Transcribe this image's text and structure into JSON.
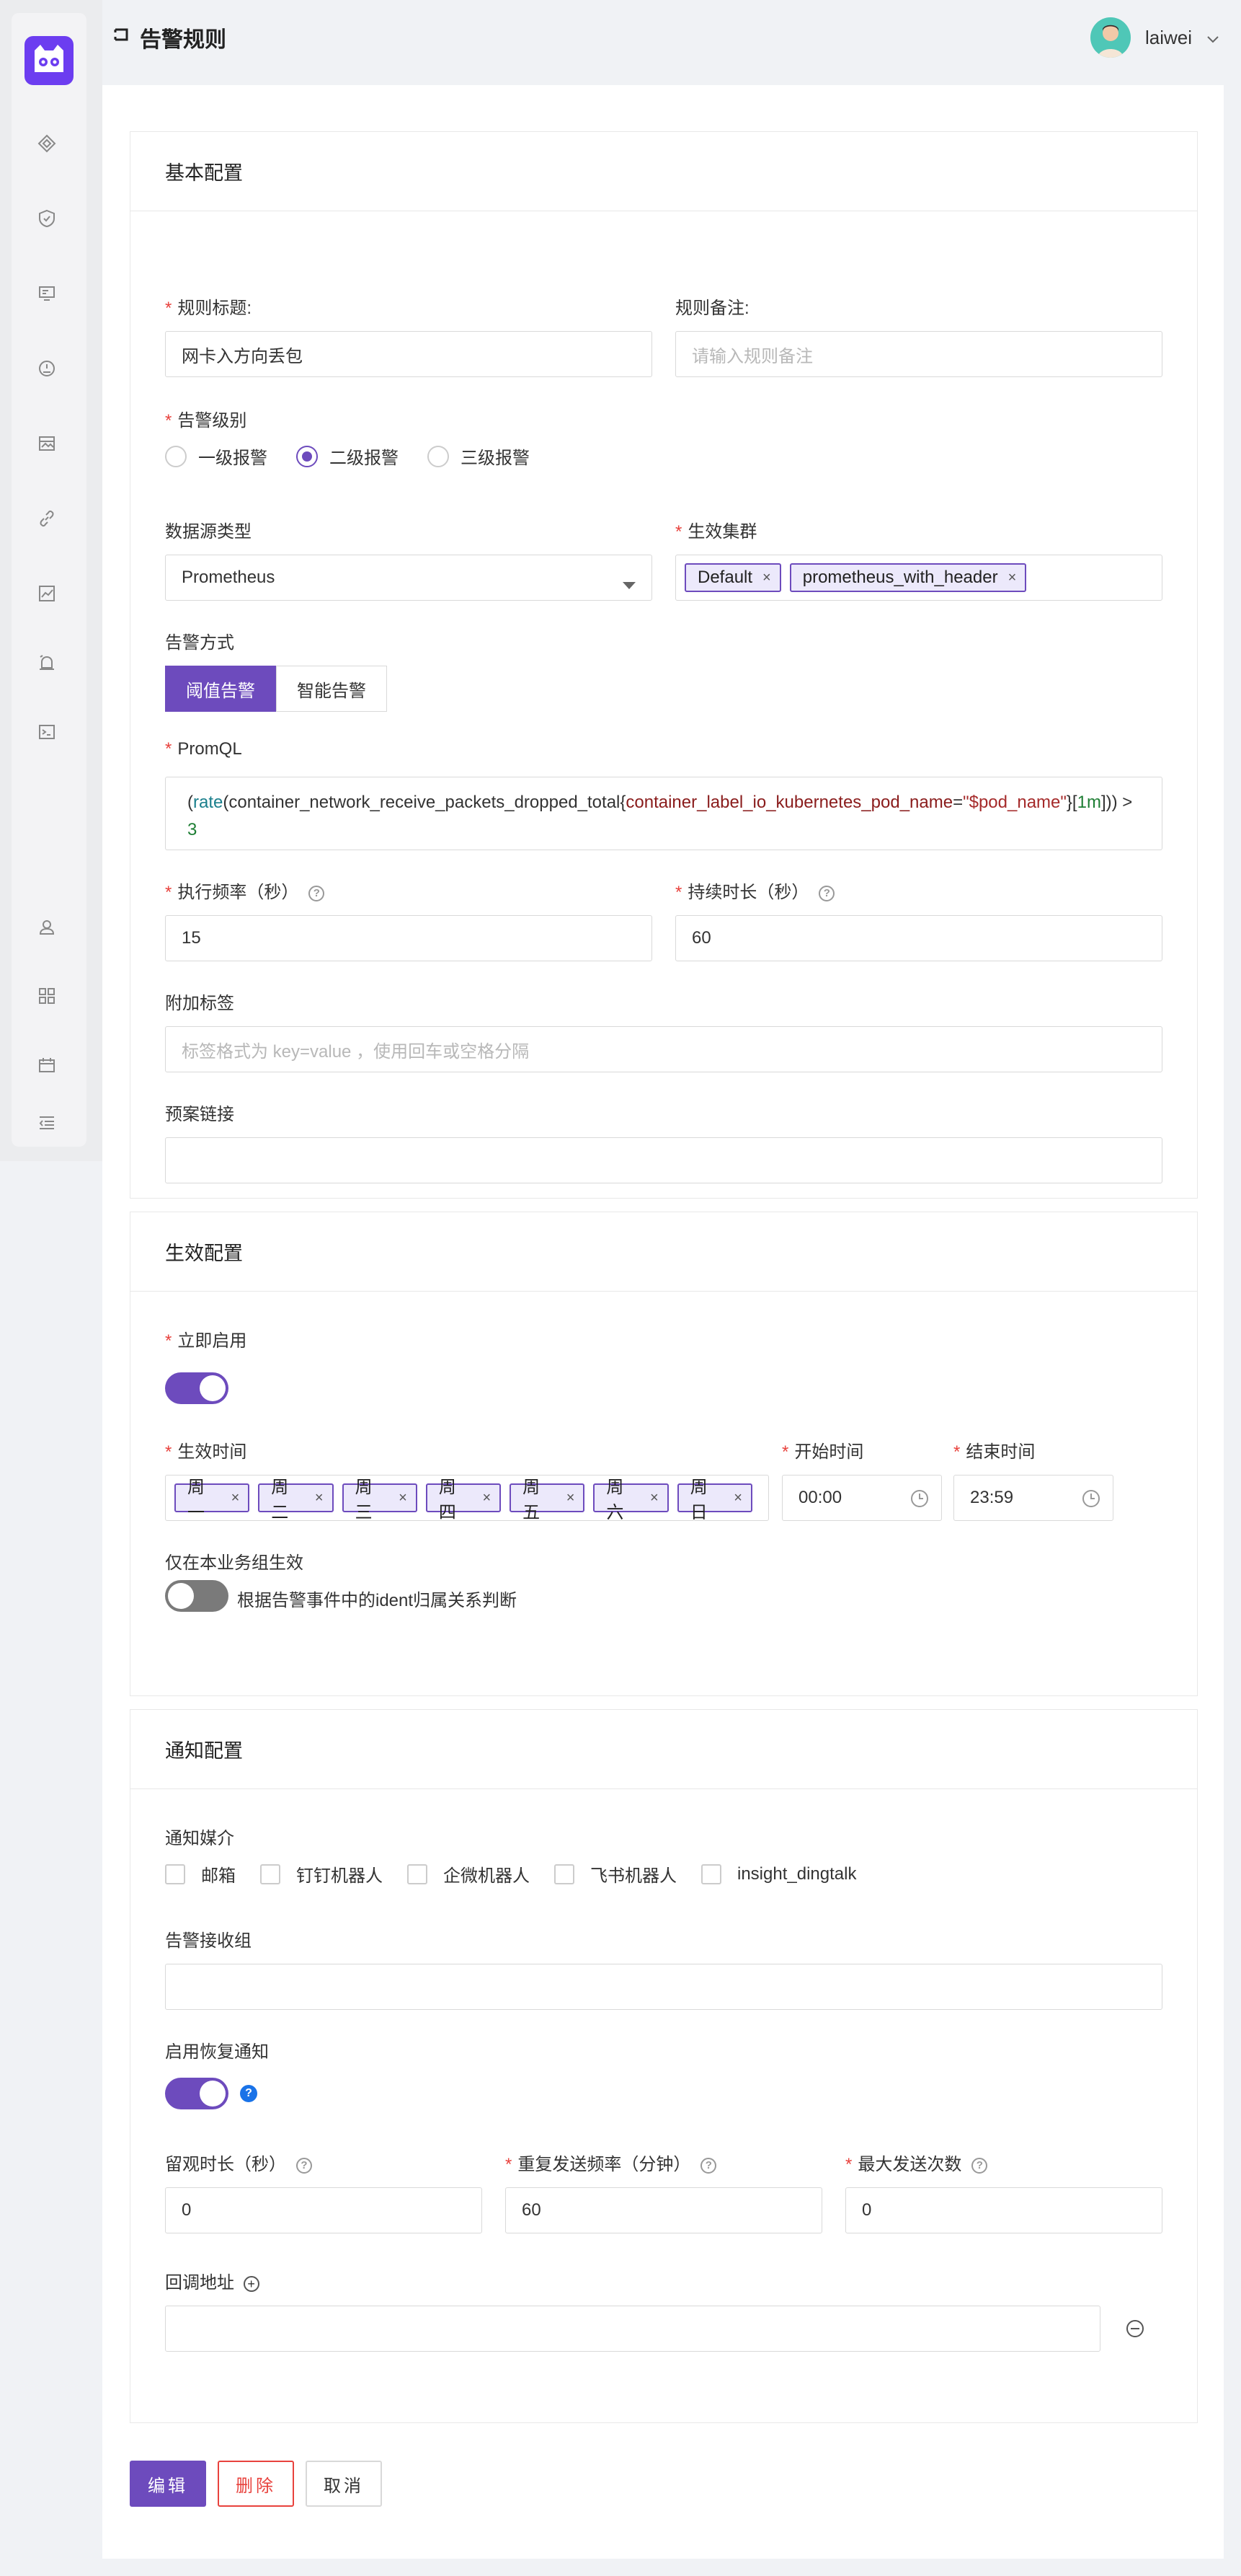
{
  "header": {
    "title": "告警规则",
    "username": "laiwei"
  },
  "basic": {
    "section_title": "基本配置",
    "rule_title_label": "规则标题:",
    "rule_title_value": "网卡入方向丢包",
    "rule_note_label": "规则备注:",
    "rule_note_placeholder": "请输入规则备注",
    "severity_label": "告警级别",
    "severity_options": [
      "一级报警",
      "二级报警",
      "三级报警"
    ],
    "severity_selected": "二级报警",
    "datasource_label": "数据源类型",
    "datasource_value": "Prometheus",
    "cluster_label": "生效集群",
    "clusters": [
      "Default",
      "prometheus_with_header"
    ],
    "alert_mode_label": "告警方式",
    "alert_modes": [
      "阈值告警",
      "智能告警"
    ],
    "promql_label": "PromQL",
    "promql": {
      "open": "(",
      "fn": "rate",
      "metric": "(container_network_receive_packets_dropped_total{",
      "label": "container_label_io_kubernetes_pod_name",
      "eq": "=",
      "value": "\"$pod_name\"",
      "close1": "}[",
      "range": "1m",
      "close2": "])) > ",
      "threshold": "3"
    },
    "eval_interval_label": "执行频率（秒）",
    "eval_interval_value": "15",
    "duration_label": "持续时长（秒）",
    "duration_value": "60",
    "extra_tags_label": "附加标签",
    "extra_tags_placeholder": "标签格式为 key=value ，使用回车或空格分隔",
    "runbook_label": "预案链接",
    "runbook_value": ""
  },
  "effective": {
    "section_title": "生效配置",
    "enable_label": "立即启用",
    "enable_on": true,
    "days_label": "生效时间",
    "days": [
      "周一",
      "周二",
      "周三",
      "周四",
      "周五",
      "周六",
      "周日"
    ],
    "start_label": "开始时间",
    "start_value": "00:00",
    "end_label": "结束时间",
    "end_value": "23:59",
    "busi_label": "仅在本业务组生效",
    "busi_on": false,
    "busi_hint": "根据告警事件中的ident归属关系判断"
  },
  "notify": {
    "section_title": "通知配置",
    "channels_label": "通知媒介",
    "channels": [
      "邮箱",
      "钉钉机器人",
      "企微机器人",
      "飞书机器人",
      "insight_dingtalk"
    ],
    "receivers_label": "告警接收组",
    "recovery_label": "启用恢复通知",
    "recovery_on": true,
    "observe_label": "留观时长（秒）",
    "observe_value": "0",
    "repeat_label": "重复发送频率（分钟）",
    "repeat_value": "60",
    "max_label": "最大发送次数",
    "max_value": "0",
    "callback_label": "回调地址"
  },
  "actions": {
    "edit": "编辑",
    "delete": "删除",
    "cancel": "取消"
  },
  "colors": {
    "primary": "#6d4bbd",
    "danger": "#e8423d"
  }
}
